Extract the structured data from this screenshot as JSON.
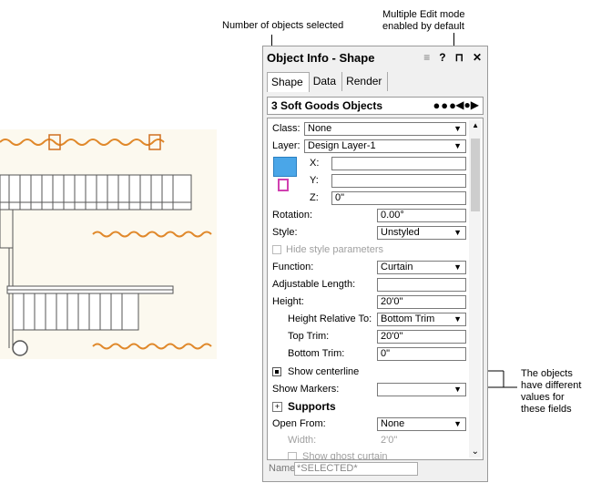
{
  "callouts": {
    "count": "Number of objects selected",
    "multi_edit_line1": "Multiple Edit mode",
    "multi_edit_line2": "enabled by default",
    "diff_line1": "The objects",
    "diff_line2": "have different",
    "diff_line3": "values for",
    "diff_line4": "these fields"
  },
  "palette": {
    "title": "Object Info - Shape",
    "icons": {
      "menu": "≡",
      "help": "?",
      "pin": "⊓",
      "close": "✕"
    },
    "tabs": [
      "Shape",
      "Data",
      "Render"
    ],
    "selection_title": "3 Soft Goods Objects",
    "class_label": "Class:",
    "class_value": "None",
    "layer_label": "Layer:",
    "layer_value": "Design Layer-1",
    "x_label": "X:",
    "x_value": "",
    "y_label": "Y:",
    "y_value": "",
    "z_label": "Z:",
    "z_value": "0\"",
    "rotation_label": "Rotation:",
    "rotation_value": "0.00°",
    "style_label": "Style:",
    "style_value": "Unstyled",
    "hide_style_label": "Hide style parameters",
    "function_label": "Function:",
    "function_value": "Curtain",
    "adj_length_label": "Adjustable Length:",
    "adj_length_value": "",
    "height_label": "Height:",
    "height_value": "20'0\"",
    "height_rel_label": "Height Relative To:",
    "height_rel_value": "Bottom Trim",
    "top_trim_label": "Top Trim:",
    "top_trim_value": "20'0\"",
    "bottom_trim_label": "Bottom Trim:",
    "bottom_trim_value": "0\"",
    "show_centerline_label": "Show centerline",
    "show_markers_label": "Show Markers:",
    "show_markers_value": "",
    "supports_label": "Supports",
    "open_from_label": "Open From:",
    "open_from_value": "None",
    "width_label": "Width:",
    "width_value": "2'0\"",
    "ghost_label": "Show ghost curtain",
    "name_label": "Name:",
    "name_value": "*SELECTED*"
  },
  "colors": {
    "curtain": "#e0882a",
    "marker": "#d07020",
    "drawing_bg": "#fcf9ef"
  }
}
